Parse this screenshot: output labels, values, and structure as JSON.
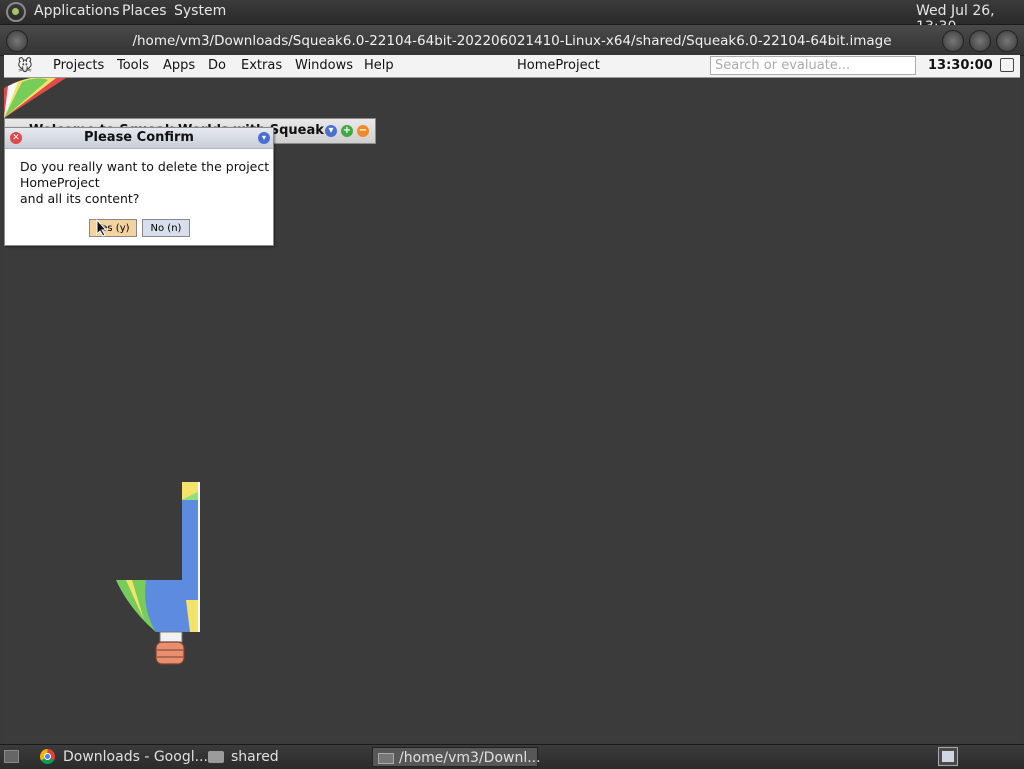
{
  "top_panel": {
    "menus": [
      "Applications",
      "Places",
      "System"
    ],
    "datetime": "Wed Jul 26, 13:30"
  },
  "window": {
    "title": "/home/vm3/Downloads/Squeak6.0-22104-64bit-202206021410-Linux-x64/shared/Squeak6.0-22104-64bit.image"
  },
  "squeak": {
    "menus": [
      "Projects",
      "Tools",
      "Apps",
      "Do",
      "Extras",
      "Windows",
      "Help"
    ],
    "project_name": "HomeProject",
    "search_placeholder": "Search or evaluate...",
    "clock": "13:30:00",
    "welcome_title": "Welcome to Squeak Worlds with Squeak"
  },
  "dialog": {
    "title": "Please Confirm",
    "message": "Do you really want to delete the project\nHomeProject\nand all its content?",
    "yes_label": "Yes (y)",
    "no_label": "No (n)"
  },
  "taskbar": {
    "items": [
      "Downloads - Googl...",
      "shared",
      "/home/vm3/Downl..."
    ]
  }
}
